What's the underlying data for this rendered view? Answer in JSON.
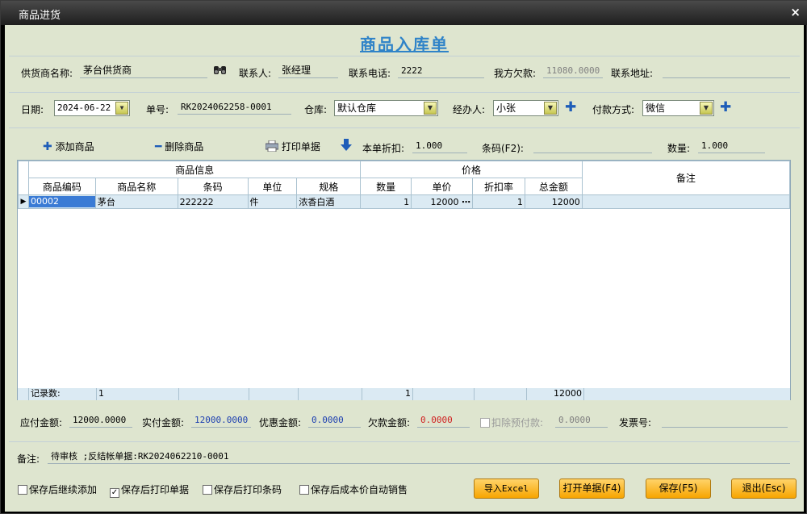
{
  "window": {
    "title": "商品进货",
    "close": "×"
  },
  "form_title": "商品入库单",
  "row1": {
    "supplier_label": "供货商名称:",
    "supplier": "茅台供货商",
    "contact_label": "联系人:",
    "contact": "张经理",
    "phone_label": "联系电话:",
    "phone": "2222",
    "owed_label": "我方欠款:",
    "owed": "11080.0000",
    "address_label": "联系地址:",
    "address": ""
  },
  "row2": {
    "date_label": "日期:",
    "date": "2024-06-22",
    "order_label": "单号:",
    "order_no": "RK2024062258-0001",
    "warehouse_label": "仓库:",
    "warehouse": "默认仓库",
    "handler_label": "经办人:",
    "handler": "小张",
    "payment_label": "付款方式:",
    "payment": "微信"
  },
  "toolbar": {
    "add": "添加商品",
    "delete": "删除商品",
    "print": "打印单据",
    "discount_label": "本单折扣:",
    "discount": "1.000",
    "barcode_label": "条码(F2):",
    "barcode": "",
    "qty_label": "数量:",
    "qty": "1.000"
  },
  "grid": {
    "group_goods": "商品信息",
    "group_price": "价格",
    "remark": "备注",
    "columns": [
      "商品编码",
      "商品名称",
      "条码",
      "单位",
      "规格",
      "数量",
      "单价",
      "折扣率",
      "总金额"
    ],
    "rows": [
      {
        "code": "00002",
        "name": "茅台",
        "barcode": "222222",
        "unit": "件",
        "spec": "浓香白酒",
        "qty": "1",
        "price": "12000",
        "rate": "1",
        "total": "12000"
      }
    ],
    "footer": {
      "label": "记录数:",
      "count": "1",
      "qty": "1",
      "total": "12000"
    }
  },
  "amounts": {
    "payable_label": "应付金额:",
    "payable": "12000.0000",
    "paid_label": "实付金额:",
    "paid": "12000.0000",
    "discount_label": "优惠金额:",
    "discount": "0.0000",
    "owe_label": "欠款金额:",
    "owe": "0.0000",
    "prepay_label": "扣除预付款:",
    "prepay": "0.0000",
    "invoice_label": "发票号:",
    "invoice": ""
  },
  "remark": {
    "label": "备注:",
    "value": "待审核 ;反结帐单据:RK2024062210-0001"
  },
  "options": [
    "保存后继续添加",
    "保存后打印单据",
    "保存后打印条码",
    "保存后成本价自动销售"
  ],
  "options_checked": [
    false,
    true,
    false,
    false
  ],
  "buttons": {
    "import": "导入Excel",
    "open": "打开单据(F4)",
    "save": "保存(F5)",
    "exit": "退出(Esc)"
  },
  "colors": {
    "title": "#2f83c8",
    "paid": "#1d3fb0",
    "owe": "#d02020",
    "accent_button": "#f7a500",
    "background": "#dee5cf"
  }
}
